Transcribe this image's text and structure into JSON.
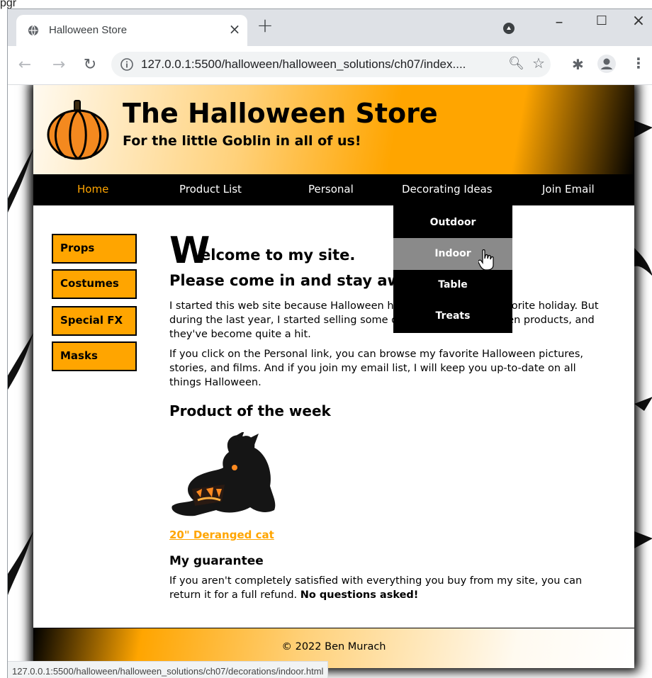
{
  "page_label": "pgr",
  "browser": {
    "tab_title": "Halloween Store",
    "url": "127.0.0.1:5500/halloween/halloween_solutions/ch07/index....",
    "status_url": "127.0.0.1:5500/halloween/halloween_solutions/ch07/decorations/indoor.html",
    "icons": {
      "tab": "globe-icon",
      "close": "close-icon",
      "new_tab": "plus-icon",
      "media": "media-icon",
      "back": "back-arrow-icon",
      "forward": "forward-arrow-icon",
      "reload": "reload-icon",
      "info": "info-icon",
      "zoom": "zoom-icon",
      "bookmark": "star-icon",
      "extensions": "puzzle-icon",
      "profile": "profile-icon",
      "menu": "kebab-menu-icon"
    }
  },
  "site": {
    "title": "The Halloween Store",
    "tagline": "For the little Goblin in all of us!",
    "nav": [
      "Home",
      "Product List",
      "Personal",
      "Decorating Ideas",
      "Join Email"
    ],
    "active_nav": "Home",
    "dropdown": [
      "Outdoor",
      "Indoor",
      "Table",
      "Treats"
    ],
    "hovered_dropdown": "Indoor",
    "sidebar": [
      "Props",
      "Costumes",
      "Special FX",
      "Masks"
    ],
    "welcome_initial": "W",
    "welcome_rest": "elcome to my site.",
    "come_in": "Please come in and stay awhile.",
    "para1": "I started this web site because Halloween has always been my favorite holiday. But during the last year, I started selling some of my favorite Halloween products, and they've become quite a hit.",
    "para2": "If you click on the Personal link, you can browse my favorite Halloween pictures, stories, and films. And if you join my email list, I will keep you up-to-date on all things Halloween.",
    "potw_heading": "Product of the week",
    "product_link": "20\" Deranged cat",
    "guarantee_heading": "My guarantee",
    "para3_text": "If you aren't completely satisfied with everything you buy from my site, you can return it for a full refund. ",
    "para3_bold": "No questions asked!",
    "footer": "© 2022 Ben Murach"
  },
  "colors": {
    "accent": "#ffa500",
    "nav_bg": "#000000",
    "hover_bg": "#8a8a8a"
  }
}
